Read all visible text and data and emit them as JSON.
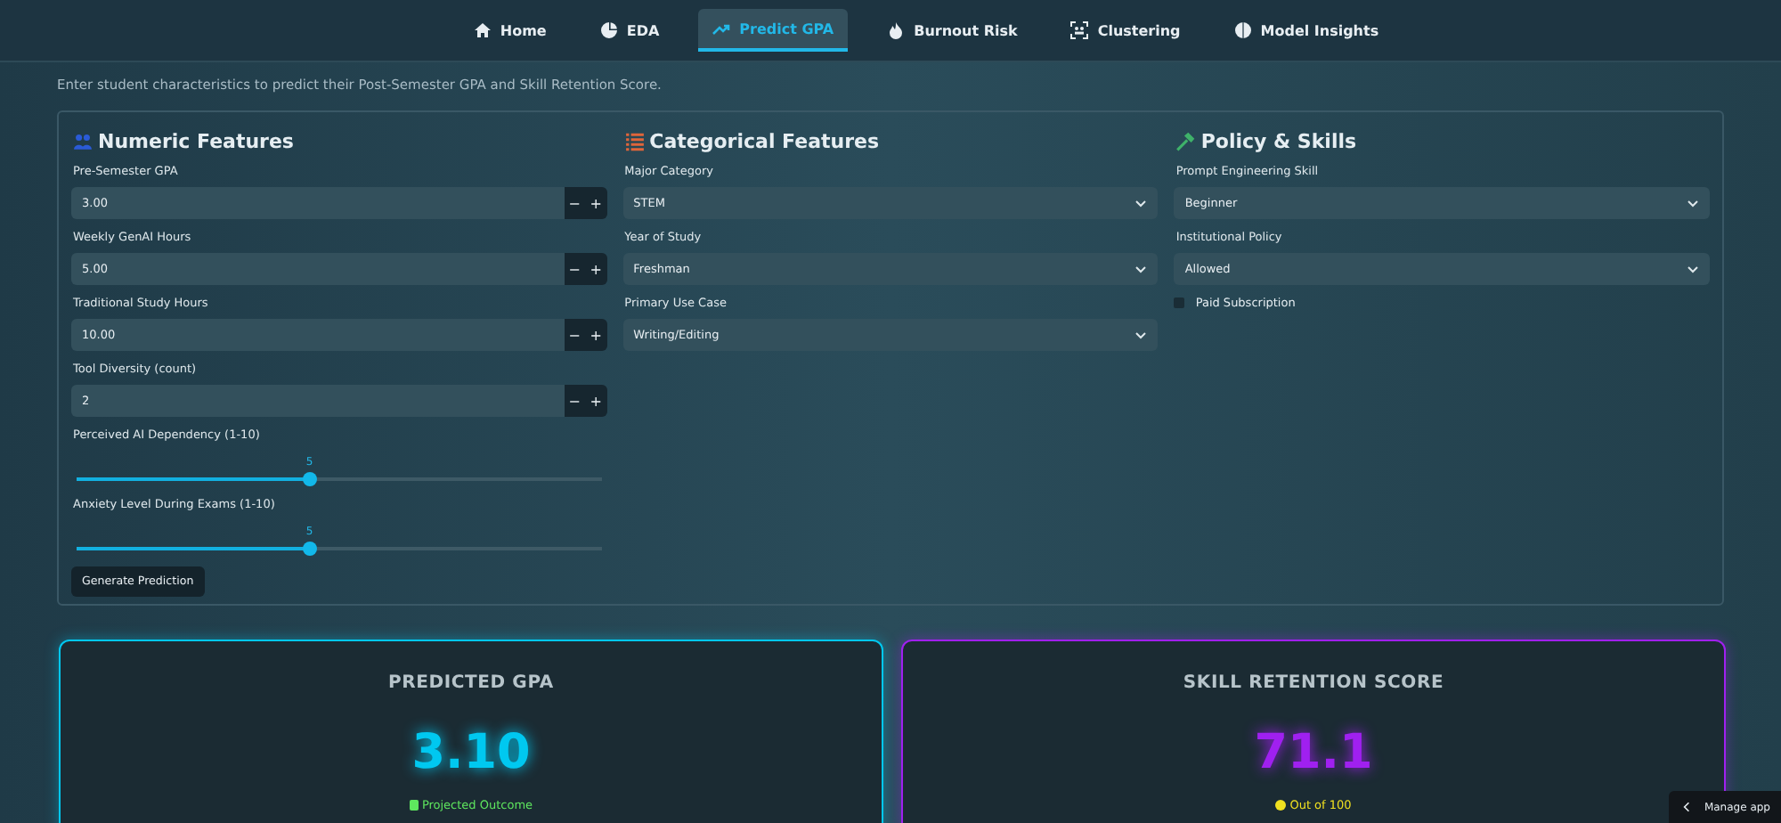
{
  "nav": [
    {
      "label": "Home",
      "selected": false
    },
    {
      "label": "EDA",
      "selected": false
    },
    {
      "label": "Predict GPA",
      "selected": true
    },
    {
      "label": "Burnout Risk",
      "selected": false
    },
    {
      "label": "Clustering",
      "selected": false
    },
    {
      "label": "Model Insights",
      "selected": false
    }
  ],
  "subtitle": "Enter student characteristics to predict their Post-Semester GPA and Skill Retention Score.",
  "columns": [
    {
      "title": "Numeric Features",
      "items": [
        {
          "kind": "number",
          "label": "Pre-Semester GPA",
          "value": "3.00",
          "minus": "−",
          "plus": "+"
        },
        {
          "kind": "number",
          "label": "Weekly GenAI Hours",
          "value": "5.00",
          "minus": "−",
          "plus": "+"
        },
        {
          "kind": "number",
          "label": "Traditional Study Hours",
          "value": "10.00",
          "minus": "−",
          "plus": "+"
        },
        {
          "kind": "number",
          "label": "Tool Diversity (count)",
          "value": "2",
          "minus": "−",
          "plus": "+"
        },
        {
          "kind": "slider",
          "label": "Perceived AI Dependency (1-10)",
          "reading": "5",
          "level": 0.444
        },
        {
          "kind": "slider",
          "label": "Anxiety Level During Exams (1-10)",
          "reading": "5",
          "level": 0.444
        },
        {
          "kind": "button",
          "label": "Generate Prediction"
        }
      ]
    },
    {
      "title": "Categorical Features",
      "items": [
        {
          "kind": "select",
          "label": "Major Category",
          "value": "STEM"
        },
        {
          "kind": "select",
          "label": "Year of Study",
          "value": "Freshman"
        },
        {
          "kind": "select",
          "label": "Primary Use Case",
          "value": "Writing/Editing"
        }
      ]
    },
    {
      "title": "Policy & Skills",
      "items": [
        {
          "kind": "select",
          "label": "Prompt Engineering Skill",
          "value": "Beginner"
        },
        {
          "kind": "select",
          "label": "Institutional Policy",
          "value": "Allowed"
        },
        {
          "kind": "checkbox",
          "label": "Paid Subscription",
          "checked": false
        }
      ]
    }
  ],
  "results": [
    {
      "title": "PREDICTED GPA",
      "value": "3.10",
      "note": "Projected Outcome",
      "color": "#00c8f0"
    },
    {
      "title": "SKILL RETENTION SCORE",
      "value": "71.1",
      "note": "Out of 100",
      "color": "#a020f0"
    }
  ],
  "manage": "Manage app"
}
